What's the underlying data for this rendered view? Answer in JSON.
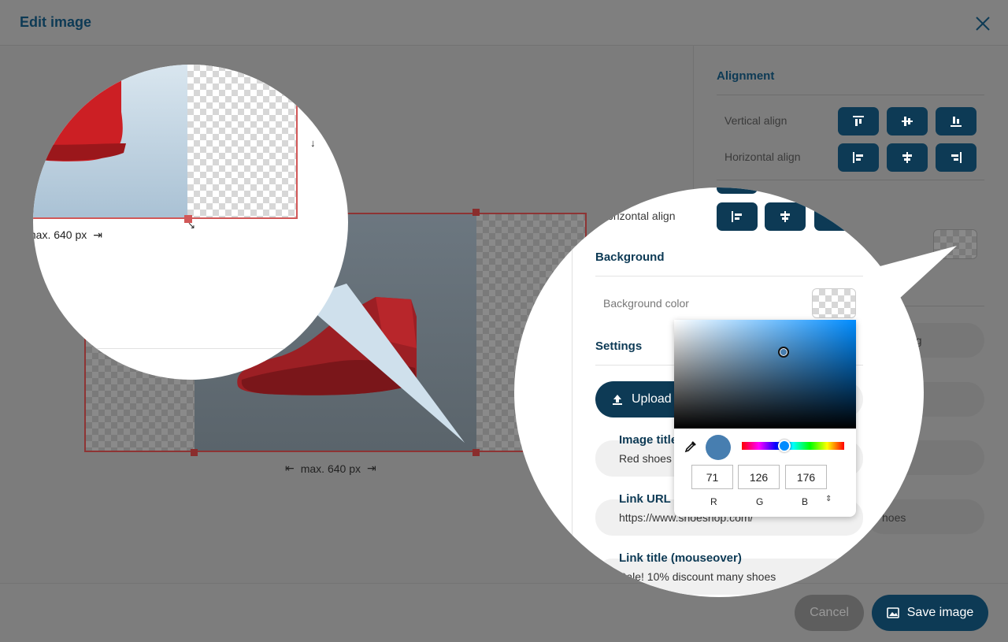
{
  "dialog": {
    "title": "Edit image"
  },
  "canvas": {
    "max_width_label": "max. 640 px"
  },
  "sidebar": {
    "alignment_heading": "Alignment",
    "vertical_align_label": "Vertical align",
    "horizontal_align_label": "Horizontal align",
    "background_heading": "Background",
    "background_color_label": "Background color",
    "settings_heading": "Settings",
    "upload_label": "Upload",
    "image_title_label": "Image title",
    "image_title_value": "Red shoes",
    "link_url_label": "Link URL",
    "link_url_value": "https://www.shoeshop.com/",
    "link_title_label": "Link title (mouseover)",
    "link_title_value": "Sale! 10% discount many shoes",
    "bg_partial_text": "ng",
    "link_partial_text": "hoes"
  },
  "color_picker": {
    "r": "71",
    "g": "126",
    "b": "176",
    "r_label": "R",
    "g_label": "G",
    "b_label": "B",
    "selected_color": "#477eb0",
    "hue_color": "#008cff"
  },
  "footer": {
    "cancel_label": "Cancel",
    "save_label": "Save image"
  },
  "colors": {
    "primary": "#0d3a55",
    "frame": "#b53b3b"
  }
}
